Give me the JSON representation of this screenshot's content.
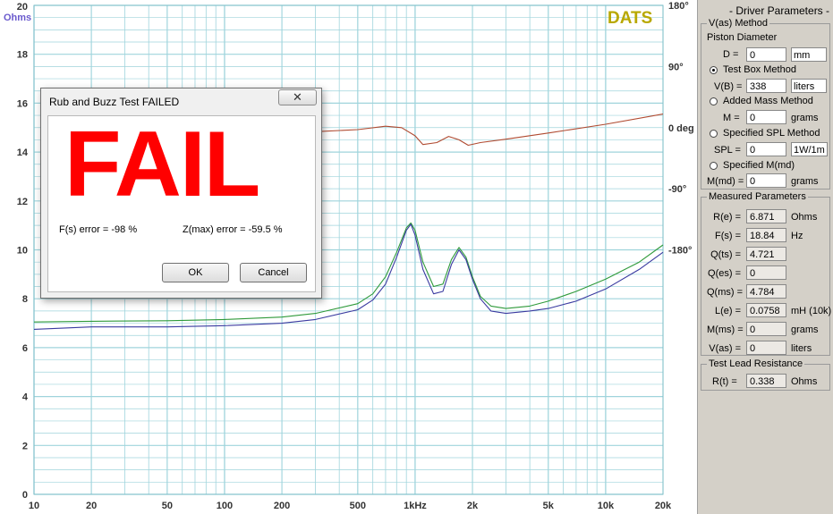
{
  "chart_data": {
    "type": "line",
    "title": "",
    "brand": "DATS",
    "ylabel": "Ohms",
    "xscale": "log",
    "xlim": [
      10,
      20000
    ],
    "ylim": [
      0,
      20
    ],
    "x_ticks": [
      10,
      20,
      50,
      100,
      200,
      500,
      1000,
      2000,
      5000,
      10000,
      20000
    ],
    "x_tick_labels": [
      "10",
      "20",
      "50",
      "100",
      "200",
      "500",
      "1kHz",
      "2k",
      "5k",
      "10k",
      "20k"
    ],
    "y_ticks": [
      0,
      2,
      4,
      6,
      8,
      10,
      12,
      14,
      16,
      18,
      20
    ],
    "phase_ticks": [
      180,
      90,
      0,
      -90,
      -180
    ],
    "phase_tick_labels": [
      "180°",
      "90°",
      "0 deg",
      "-90°",
      "-180°"
    ],
    "phase_ylim": [
      -540,
      180
    ],
    "grid": true,
    "colors": {
      "green": "#2f9a3a",
      "blue": "#3a3aa0",
      "phase": "#b04a30",
      "grid": "#9fd4dc",
      "brand": "#b8a800",
      "label": "#6a5acd"
    },
    "series": [
      {
        "key": "green",
        "x": [
          10,
          20,
          50,
          100,
          200,
          300,
          500,
          600,
          700,
          800,
          900,
          950,
          1000,
          1100,
          1250,
          1400,
          1550,
          1700,
          1850,
          2000,
          2200,
          2500,
          3000,
          4000,
          5000,
          7000,
          10000,
          15000,
          20000
        ],
        "y": [
          7.05,
          7.08,
          7.1,
          7.15,
          7.25,
          7.4,
          7.8,
          8.2,
          8.9,
          9.9,
          10.9,
          11.1,
          10.8,
          9.5,
          8.5,
          8.6,
          9.6,
          10.1,
          9.7,
          8.9,
          8.1,
          7.7,
          7.6,
          7.7,
          7.9,
          8.3,
          8.8,
          9.5,
          10.2
        ]
      },
      {
        "key": "blue",
        "x": [
          10,
          20,
          50,
          100,
          200,
          300,
          500,
          600,
          700,
          800,
          900,
          950,
          1000,
          1100,
          1250,
          1400,
          1550,
          1700,
          1850,
          2000,
          2200,
          2500,
          3000,
          4000,
          5000,
          7000,
          10000,
          15000,
          20000
        ],
        "y": [
          6.75,
          6.85,
          6.85,
          6.9,
          7.0,
          7.15,
          7.55,
          7.95,
          8.6,
          9.7,
          10.8,
          11.05,
          10.6,
          9.2,
          8.2,
          8.3,
          9.4,
          10.0,
          9.6,
          8.8,
          8.0,
          7.5,
          7.4,
          7.5,
          7.6,
          7.9,
          8.4,
          9.2,
          9.9
        ]
      },
      {
        "key": "phase",
        "x": [
          200,
          300,
          500,
          700,
          850,
          1000,
          1100,
          1300,
          1500,
          1700,
          1900,
          2200,
          3000,
          5000,
          10000,
          20000
        ],
        "y": [
          -9,
          -6,
          -3,
          2,
          0,
          -12,
          -25,
          -22,
          -13,
          -18,
          -26,
          -22,
          -17,
          -8,
          5,
          20
        ]
      }
    ]
  },
  "dialog": {
    "title": "Rub and Buzz Test FAILED",
    "close": "✕",
    "big_text": "FAIL",
    "fs_error": "F(s) error = -98 %",
    "zmax_error": "Z(max) error = -59.5 %",
    "ok": "OK",
    "cancel": "Cancel"
  },
  "panel": {
    "header": "- Driver Parameters -",
    "vas_group": "V(as) Method",
    "piston_diameter": "Piston Diameter",
    "d_label": "D =",
    "d_value": "0",
    "d_unit": "mm",
    "test_box": "Test Box Method",
    "vb_label": "V(B) =",
    "vb_value": "338",
    "vb_unit": "liters",
    "added_mass": "Added Mass Method",
    "m_label": "M =",
    "m_value": "0",
    "m_unit": "grams",
    "spl_method": "Specified SPL Method",
    "spl_label": "SPL =",
    "spl_value": "0",
    "spl_unit": "1W/1m",
    "mmd_method": "Specified M(md)",
    "mmd_label": "M(md) =",
    "mmd_value": "0",
    "mmd_unit": "grams",
    "measured_group": "Measured Parameters",
    "measured": [
      {
        "label": "R(e) =",
        "value": "6.871",
        "unit": "Ohms"
      },
      {
        "label": "F(s) =",
        "value": "18.84",
        "unit": "Hz"
      },
      {
        "label": "Q(ts) =",
        "value": "4.721",
        "unit": ""
      },
      {
        "label": "Q(es) =",
        "value": "0",
        "unit": ""
      },
      {
        "label": "Q(ms) =",
        "value": "4.784",
        "unit": ""
      },
      {
        "label": "L(e) =",
        "value": "0.0758",
        "unit": "mH (10k)"
      },
      {
        "label": "M(ms) =",
        "value": "0",
        "unit": "grams"
      },
      {
        "label": "V(as) =",
        "value": "0",
        "unit": "liters"
      }
    ],
    "lead_group": "Test Lead Resistance",
    "rt_label": "R(t) =",
    "rt_value": "0.338",
    "rt_unit": "Ohms"
  }
}
